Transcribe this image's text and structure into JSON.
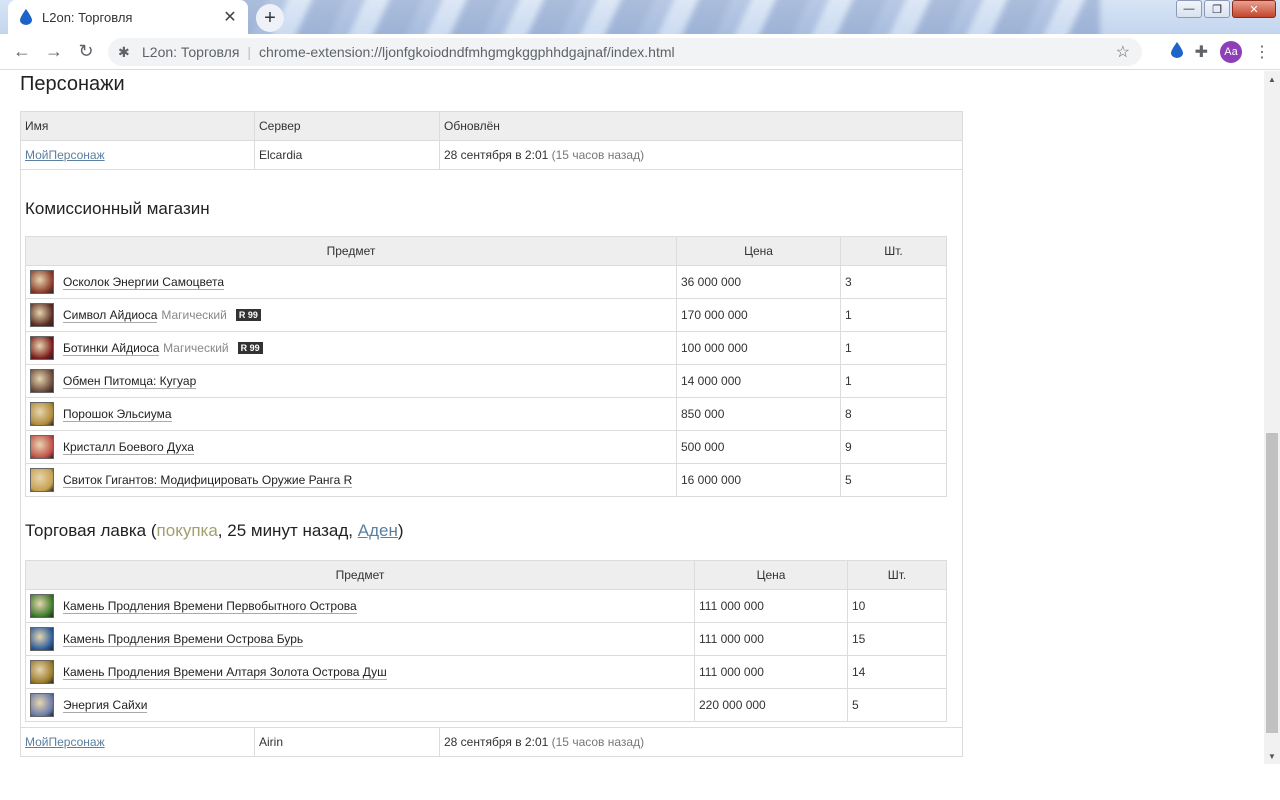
{
  "browser": {
    "tab_title": "L2on: Торговля",
    "site_name": "L2on: Торговля",
    "url": "chrome-extension://ljonfgkoiodndfmhgmgkggphhdgajnaf/index.html",
    "avatar_initials": "Aa"
  },
  "page": {
    "heading": "Персонажи",
    "columns": [
      "Имя",
      "Сервер",
      "Обновлён"
    ],
    "characters": [
      {
        "name": "МойПерсонаж",
        "server": "Elcardia",
        "updated": "28 сентября в 2:01",
        "ago": "(15 часов назад)"
      },
      {
        "name": "МойПерсонаж",
        "server": "Airin",
        "updated": "28 сентября в 2:01",
        "ago": "(15 часов назад)"
      }
    ],
    "commission": {
      "title": "Комиссионный магазин",
      "columns": [
        "Предмет",
        "Цена",
        "Шт."
      ],
      "rows": [
        {
          "name": "Осколок Энергии Самоцвета",
          "grade": "",
          "rank": "",
          "price": "36 000 000",
          "qty": "3",
          "icon_color": "#8a3a2a"
        },
        {
          "name": "Символ Айдиоса",
          "grade": "Магический",
          "rank": "R 99",
          "price": "170 000 000",
          "qty": "1",
          "icon_color": "#5a2a22"
        },
        {
          "name": "Ботинки Айдиоса",
          "grade": "Магический",
          "rank": "R 99",
          "price": "100 000 000",
          "qty": "1",
          "icon_color": "#7a1a1a"
        },
        {
          "name": "Обмен Питомца: Кугуар",
          "grade": "",
          "rank": "",
          "price": "14 000 000",
          "qty": "1",
          "icon_color": "#6a4a3a"
        },
        {
          "name": "Порошок Эльсиума",
          "grade": "",
          "rank": "",
          "price": "850 000",
          "qty": "8",
          "icon_color": "#b08a3a"
        },
        {
          "name": "Кристалл Боевого Духа",
          "grade": "",
          "rank": "",
          "price": "500 000",
          "qty": "9",
          "icon_color": "#c0504a"
        },
        {
          "name": "Свиток Гигантов: Модифицировать Оружие Ранга R",
          "grade": "",
          "rank": "",
          "price": "16 000 000",
          "qty": "5",
          "icon_color": "#c8a050"
        }
      ]
    },
    "shop": {
      "title_prefix": "Торговая лавка (",
      "mode": "покупка",
      "time": ", 25 минут назад, ",
      "city": "Аден",
      "title_suffix": ")",
      "columns": [
        "Предмет",
        "Цена",
        "Шт."
      ],
      "rows": [
        {
          "name": "Камень Продления Времени Первобытного Острова",
          "price": "111 000 000",
          "qty": "10",
          "icon_color": "#3a7a2a"
        },
        {
          "name": "Камень Продления Времени Острова Бурь",
          "price": "111 000 000",
          "qty": "15",
          "icon_color": "#2a5a9a"
        },
        {
          "name": "Камень Продления Времени Алтаря Золота Острова Душ",
          "price": "111 000 000",
          "qty": "14",
          "icon_color": "#9a7a2a"
        },
        {
          "name": "Энергия Сайхи",
          "price": "220 000 000",
          "qty": "5",
          "icon_color": "#6a7aa8"
        }
      ]
    }
  }
}
